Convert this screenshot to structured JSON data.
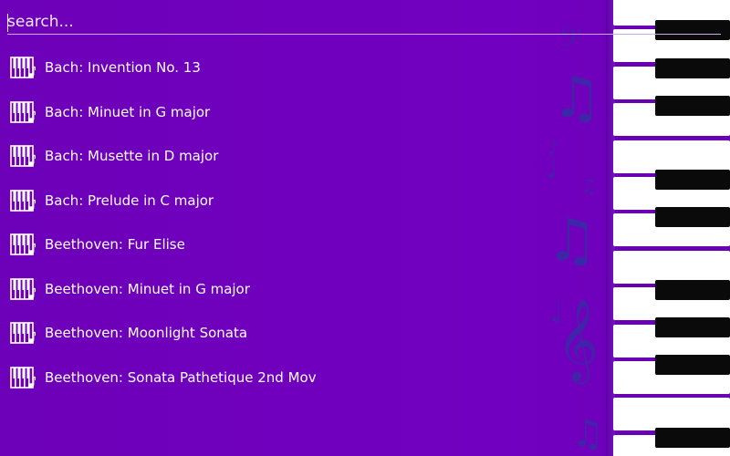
{
  "search": {
    "placeholder": "search...",
    "value": ""
  },
  "songs": [
    {
      "label": "Bach: Invention No. 13",
      "icon": "piano-note-icon"
    },
    {
      "label": "Bach: Minuet in G major",
      "icon": "piano-note-icon"
    },
    {
      "label": "Bach: Musette in D major",
      "icon": "piano-note-icon"
    },
    {
      "label": "Bach: Prelude in C major",
      "icon": "piano-note-icon"
    },
    {
      "label": "Beethoven: Fur Elise",
      "icon": "piano-note-icon"
    },
    {
      "label": "Beethoven: Minuet in G major",
      "icon": "piano-note-icon"
    },
    {
      "label": "Beethoven: Moonlight Sonata",
      "icon": "piano-note-icon"
    },
    {
      "label": "Beethoven: Sonata Pathetique 2nd Mov",
      "icon": "piano-note-icon"
    }
  ],
  "decorations": {
    "icons": [
      "bass-clef-icon",
      "beamed-notes-icon",
      "eighth-note-icon",
      "treble-clef-icon",
      "piano-keys-icon"
    ]
  },
  "colors": {
    "background": "#7000b8",
    "note_tint": "#3a2aa8",
    "text": "#ffffff",
    "piano_black": "#0a0a0a",
    "piano_white": "#ffffff"
  }
}
